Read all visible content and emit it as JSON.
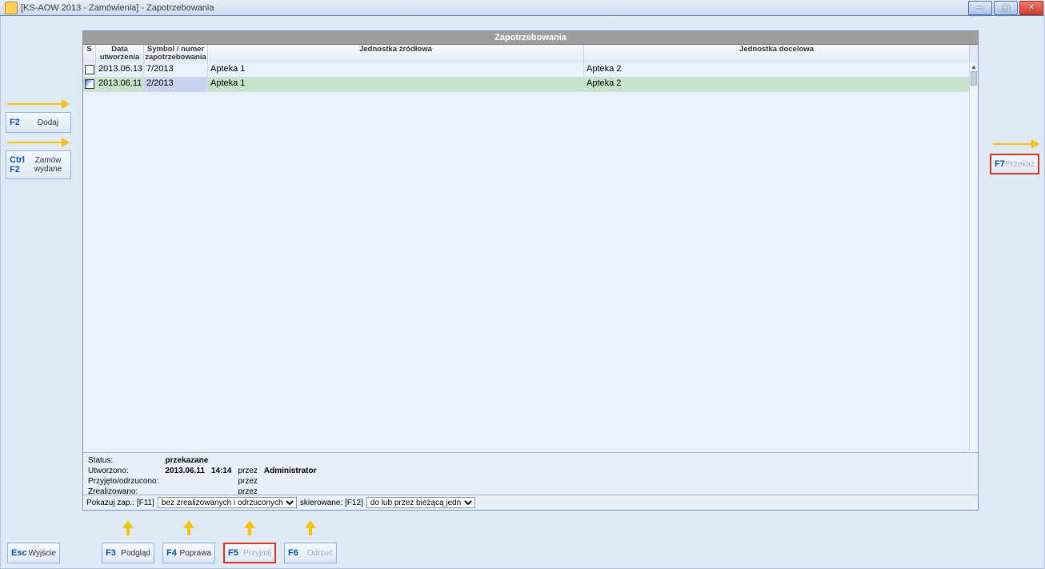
{
  "window": {
    "title": "[KS-AOW 2013 - Zamówienia] - Zapotrzebowania"
  },
  "grid": {
    "title": "Zapotrzebowania",
    "columns": {
      "s": "S",
      "date": "Data utworzenia",
      "symbol": "Symbol / numer zapotrzebowania",
      "src": "Jednostka źródłowa",
      "dst": "Jednostka docelowa"
    },
    "rows": [
      {
        "icon": "doc",
        "date": "2013.06.13",
        "symbol": "7/2013",
        "src": "Apteka 1",
        "dst": "Apteka 2",
        "selected": false
      },
      {
        "icon": "send",
        "date": "2013.06.11",
        "symbol": "2/2013",
        "src": "Apteka 1",
        "dst": "Apteka 2",
        "selected": true
      }
    ]
  },
  "info": {
    "status_label": "Status:",
    "status_value": "przekazane",
    "created_label": "Utworzono:",
    "created_date": "2013.06.11",
    "created_time": "14:14",
    "by_label": "przez",
    "created_by": "Administrator",
    "accepted_label": "Przyjęto/odrzucono:",
    "accepted_date": "",
    "accepted_by": "",
    "realized_label": "Zrealizowano:",
    "realized_date": "",
    "realized_by": ""
  },
  "filters": {
    "show_label": "Pokazuj zap.: [F11]",
    "show_value": "bez zrealizowanych i odrzuconych",
    "directed_label": "skierowane: [F12]",
    "directed_value": "do lub przez bieżącą jedn"
  },
  "buttons": {
    "f2_key": "F2",
    "f2_label": "Dodaj",
    "ctrl_f2_key": "Ctrl F2",
    "ctrl_f2_label": "Zamów wydane",
    "f7_key": "F7",
    "f7_label": "Przekaż",
    "esc_key": "Esc",
    "esc_label": "Wyjście",
    "f3_key": "F3",
    "f3_label": "Podgląd",
    "f4_key": "F4",
    "f4_label": "Poprawa",
    "f5_key": "F5",
    "f5_label": "Przyjmij",
    "f6_key": "F6",
    "f6_label": "Odrzuć"
  }
}
